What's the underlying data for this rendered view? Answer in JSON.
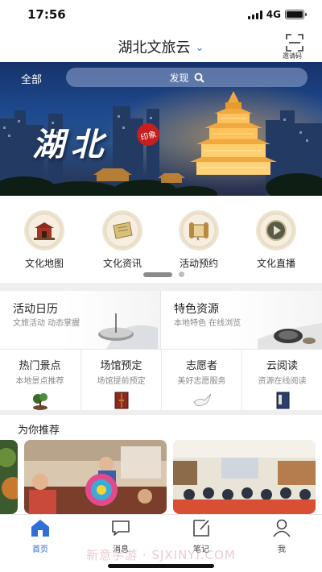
{
  "status": {
    "time": "17:56",
    "network": "4G"
  },
  "header": {
    "title": "湖北文旅云",
    "invite_label": "邀请码"
  },
  "banner": {
    "all_label": "全部",
    "search_label": "发现",
    "calligraphy": "湖北",
    "seal_text": "印象"
  },
  "quick_links": [
    {
      "label": "文化地图",
      "icon": "map-building-icon"
    },
    {
      "label": "文化资讯",
      "icon": "scroll-icon"
    },
    {
      "label": "活动预约",
      "icon": "scroll-book-icon"
    },
    {
      "label": "文化直播",
      "icon": "play-icon"
    }
  ],
  "features": [
    {
      "title": "活动日历",
      "subtitle": "文旅活动 动态掌握"
    },
    {
      "title": "特色资源",
      "subtitle": "本地特色 在线浏览"
    }
  ],
  "services": [
    {
      "title": "热门景点",
      "subtitle": "本地景点推荐",
      "icon": "bonsai-icon"
    },
    {
      "title": "场馆预定",
      "subtitle": "场馆提前预定",
      "icon": "cabinet-icon"
    },
    {
      "title": "志愿者",
      "subtitle": "美好志愿服务",
      "icon": "dove-icon"
    },
    {
      "title": "云阅读",
      "subtitle": "资源在线阅读",
      "icon": "book-icon"
    }
  ],
  "recommend": {
    "title": "为你推荐"
  },
  "tabs": [
    {
      "label": "首页",
      "icon": "home-icon",
      "active": true
    },
    {
      "label": "消息",
      "icon": "message-icon",
      "active": false
    },
    {
      "label": "笔记",
      "icon": "note-icon",
      "active": false
    },
    {
      "label": "我",
      "icon": "user-icon",
      "active": false
    }
  ],
  "watermark": "新意手游 · SJXINYI.COM",
  "colors": {
    "accent": "#2f6fd6",
    "banner": "#1f4a8f",
    "seal": "#c81e1e"
  }
}
